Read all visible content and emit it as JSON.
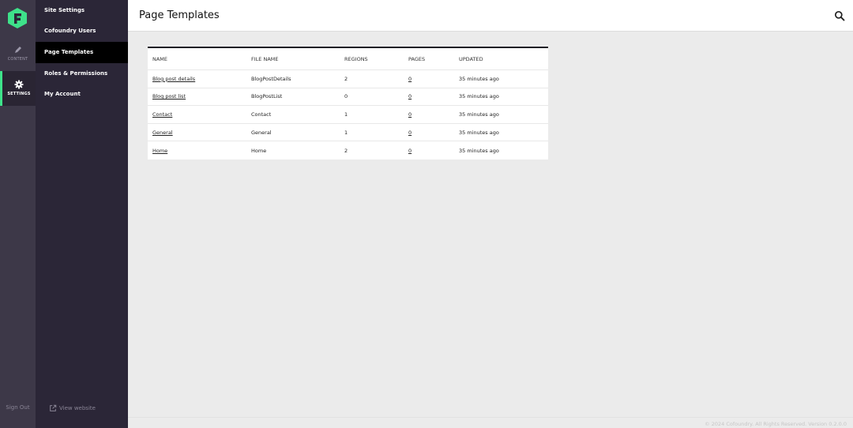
{
  "rail": {
    "content_label": "CONTENT",
    "settings_label": "SETTINGS",
    "sign_out": "Sign Out"
  },
  "subnav": {
    "items": [
      {
        "label": "Site Settings"
      },
      {
        "label": "Cofoundry Users"
      },
      {
        "label": "Page Templates"
      },
      {
        "label": "Roles & Permissions"
      },
      {
        "label": "My Account"
      }
    ],
    "active_index": 2,
    "view_website": "View website"
  },
  "header": {
    "title": "Page Templates"
  },
  "table": {
    "columns": [
      "NAME",
      "FILE NAME",
      "REGIONS",
      "PAGES",
      "UPDATED"
    ],
    "rows": [
      {
        "name": "Blog post details",
        "file_name": "BlogPostDetails",
        "regions": "2",
        "pages": "0",
        "updated": "35 minutes ago"
      },
      {
        "name": "Blog post list",
        "file_name": "BlogPostList",
        "regions": "0",
        "pages": "0",
        "updated": "35 minutes ago"
      },
      {
        "name": "Contact",
        "file_name": "Contact",
        "regions": "1",
        "pages": "0",
        "updated": "35 minutes ago"
      },
      {
        "name": "General",
        "file_name": "General",
        "regions": "1",
        "pages": "0",
        "updated": "35 minutes ago"
      },
      {
        "name": "Home",
        "file_name": "Home",
        "regions": "2",
        "pages": "0",
        "updated": "35 minutes ago"
      }
    ]
  },
  "footer": {
    "copyright": "© 2024 Cofoundry. All Rights Reserved. Version 0.2.0.0"
  },
  "colors": {
    "accent": "#3ee28a",
    "rail_bg": "#3d3848",
    "subnav_bg": "#2b2637",
    "active_item_bg": "#000000"
  }
}
